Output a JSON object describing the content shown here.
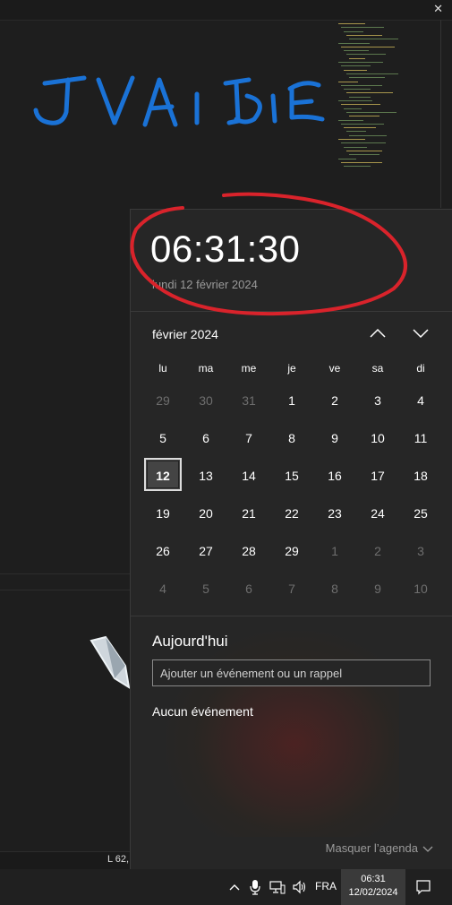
{
  "background": {
    "close_glyph": "✕",
    "status_text": "L 62,"
  },
  "clock": {
    "time": "06:31:30",
    "date": "lundi 12 février 2024"
  },
  "calendar": {
    "month_label": "février 2024",
    "weekdays": [
      "lu",
      "ma",
      "me",
      "je",
      "ve",
      "sa",
      "di"
    ],
    "weeks": [
      [
        {
          "d": "29",
          "m": true
        },
        {
          "d": "30",
          "m": true
        },
        {
          "d": "31",
          "m": true
        },
        {
          "d": "1"
        },
        {
          "d": "2"
        },
        {
          "d": "3"
        },
        {
          "d": "4"
        }
      ],
      [
        {
          "d": "5"
        },
        {
          "d": "6"
        },
        {
          "d": "7"
        },
        {
          "d": "8"
        },
        {
          "d": "9"
        },
        {
          "d": "10"
        },
        {
          "d": "11"
        }
      ],
      [
        {
          "d": "12",
          "today": true
        },
        {
          "d": "13"
        },
        {
          "d": "14"
        },
        {
          "d": "15"
        },
        {
          "d": "16"
        },
        {
          "d": "17"
        },
        {
          "d": "18"
        }
      ],
      [
        {
          "d": "19"
        },
        {
          "d": "20"
        },
        {
          "d": "21"
        },
        {
          "d": "22"
        },
        {
          "d": "23"
        },
        {
          "d": "24"
        },
        {
          "d": "25"
        }
      ],
      [
        {
          "d": "26"
        },
        {
          "d": "27"
        },
        {
          "d": "28"
        },
        {
          "d": "29"
        },
        {
          "d": "1",
          "m": true
        },
        {
          "d": "2",
          "m": true
        },
        {
          "d": "3",
          "m": true
        }
      ],
      [
        {
          "d": "4",
          "m": true
        },
        {
          "d": "5",
          "m": true
        },
        {
          "d": "6",
          "m": true
        },
        {
          "d": "7",
          "m": true
        },
        {
          "d": "8",
          "m": true
        },
        {
          "d": "9",
          "m": true
        },
        {
          "d": "10",
          "m": true
        }
      ]
    ],
    "prev_icon": "chevron-up-icon",
    "next_icon": "chevron-down-icon"
  },
  "agenda": {
    "title": "Aujourd'hui",
    "input_placeholder": "Ajouter un événement ou un rappel",
    "no_events": "Aucun événement",
    "hide_label": "Masquer l’agenda"
  },
  "taskbar": {
    "language": "FRA",
    "time": "06:31",
    "date": "12/02/2024",
    "icons": [
      "chevron-up-icon",
      "microphone-icon",
      "network-icon",
      "volume-icon",
      "notification-icon"
    ]
  },
  "colors": {
    "annotation_red": "#d9232b",
    "drawing_blue": "#1a72d6",
    "flyout_bg": "#262626",
    "taskbar_bg": "#202020"
  }
}
